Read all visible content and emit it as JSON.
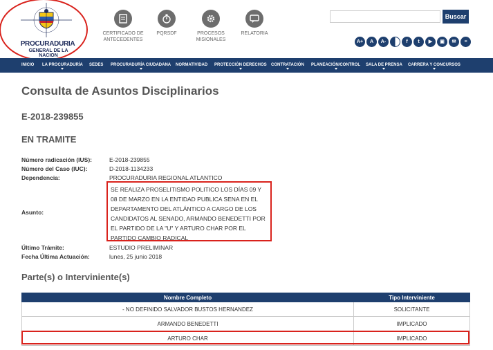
{
  "logo": {
    "line1": "PROCURADURIA",
    "line2": "GENERAL DE LA NACION"
  },
  "quick_links": [
    {
      "label": "CERTIFICADO DE ANTECEDENTES",
      "icon": "document-icon"
    },
    {
      "label": "PQRSDF",
      "icon": "stopwatch-icon"
    },
    {
      "label": "PROCESOS MISIONALES",
      "icon": "gear-icon"
    },
    {
      "label": "RELATORIA",
      "icon": "chat-icon"
    }
  ],
  "search": {
    "placeholder": "",
    "button": "Buscar"
  },
  "accessibility": [
    "A+",
    "A",
    "A-"
  ],
  "social": [
    "f",
    "t",
    "▶",
    "▣",
    "✉",
    "≡"
  ],
  "nav": [
    "Inicio",
    "La Procuraduría",
    "Sedes",
    "Procuraduría Ciudadana",
    "Normatividad",
    "Protección Derechos",
    "Contratación",
    "Planeación/Control",
    "Sala de Prensa",
    "Carrera y Concursos"
  ],
  "page": {
    "title": "Consulta de Asuntos Disciplinarios",
    "case_id": "E-2018-239855",
    "status": "EN TRAMITE"
  },
  "details": {
    "radicacion_label": "Número radicación (IUS):",
    "radicacion_value": "E-2018-239855",
    "caso_label": "Número del Caso (IUC):",
    "caso_value": "D-2018-1134233",
    "dependencia_label": "Dependencia:",
    "dependencia_value": "PROCURADURIA REGIONAL ATLANTICO",
    "asunto_label": "Asunto:",
    "asunto_value": "SE REALIZA PROSELITISMO POLITICO LOS DÍAS 09 Y 08 DE MARZO EN LA ENTIDAD PUBLICA SENA EN EL DEPARTAMENTO DEL ATLÁNTICO A CARGO DE LOS CANDIDATOS AL SENADO, ARMANDO BENEDETTI POR EL PARTIDO DE LA \"U\" Y ARTURO CHAR POR EL PARTIDO CAMBIO RADICAL",
    "tramite_label": "Último Trámite:",
    "tramite_value": "ESTUDIO PRELIMINAR",
    "fecha_label": "Fecha Última Actuación:",
    "fecha_value": "lunes, 25 junio 2018"
  },
  "parties": {
    "title": "Parte(s) o Interviniente(s)",
    "headers": [
      "Nombre Completo",
      "Tipo Interviniente"
    ],
    "rows": [
      [
        "- NO DEFINIDO SALVADOR BUSTOS HERNANDEZ",
        "SOLICITANTE"
      ],
      [
        "ARMANDO BENEDETTI",
        "IMPLICADO"
      ],
      [
        "ARTURO CHAR",
        "IMPLICADO"
      ]
    ]
  }
}
